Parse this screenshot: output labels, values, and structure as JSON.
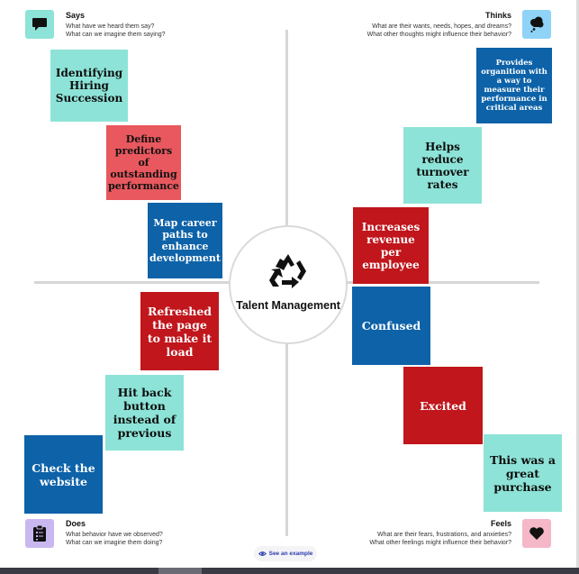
{
  "quadrants": {
    "says": {
      "title": "Says",
      "q1": "What have we heard them say?",
      "q2": "What can we imagine them saying?",
      "color": "#8de3d7",
      "icon": "speech-bubble-icon"
    },
    "thinks": {
      "title": "Thinks",
      "q1": "What are their wants, needs, hopes, and dreams?",
      "q2": "What other thoughts might influence their behavior?",
      "color": "#8fd3f7",
      "icon": "thought-cloud-icon"
    },
    "does": {
      "title": "Does",
      "q1": "What behavior have we observed?",
      "q2": "What can we imagine them doing?",
      "color": "#c9b8f0",
      "icon": "clipboard-icon"
    },
    "feels": {
      "title": "Feels",
      "q1": "What are their fears, frustrations, and anxieties?",
      "q2": "What other feelings might influence their behavior?",
      "color": "#f4b8c8",
      "icon": "heart-icon"
    }
  },
  "center": {
    "title": "Talent Management",
    "icon": "recycle-icon"
  },
  "stickies": {
    "s1": "Identifying Hiring Succession",
    "s2": "Define predictors of outstanding performance",
    "s3": "Map career paths to enhance development",
    "t1": "Provides organition with a way to measure their performance in critical areas",
    "t2": "Helps reduce turnover rates",
    "t3": "Increases revenue per employee",
    "d1": "Refreshed the page to make it load",
    "d2": "Hit back button instead of previous",
    "d3": "Check the website",
    "f1": "Confused",
    "f2": "Excited",
    "f3": "This was a great purchase"
  },
  "footer": {
    "example_label": "See an example"
  }
}
